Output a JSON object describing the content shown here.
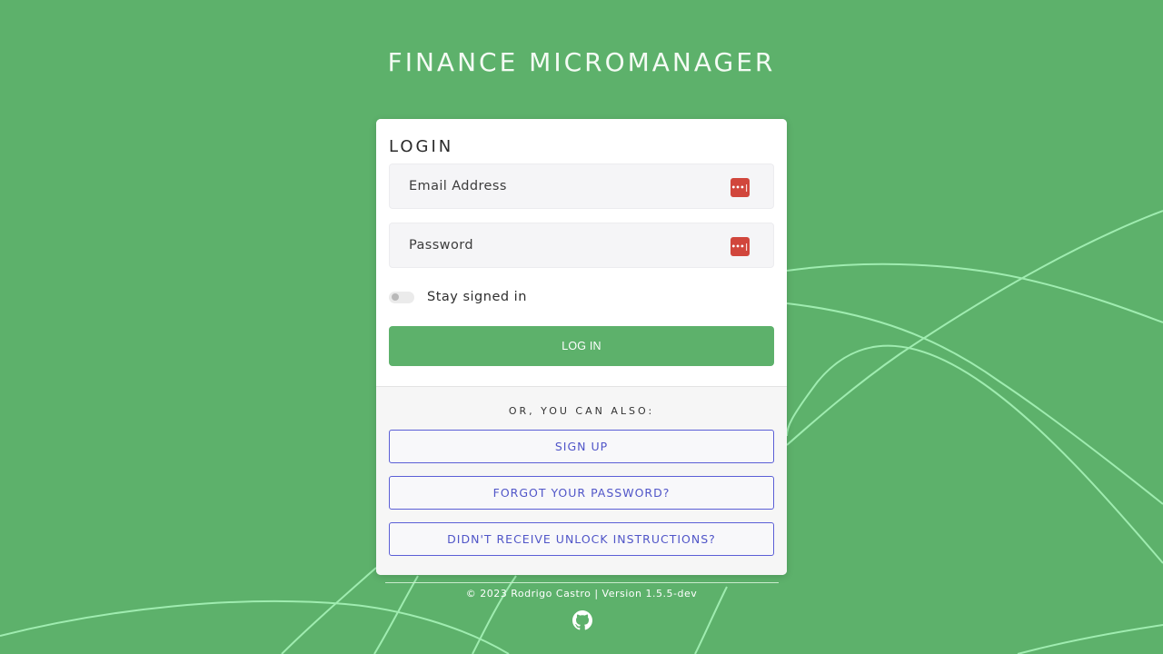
{
  "app": {
    "title": "FINANCE MICROMANAGER"
  },
  "login": {
    "heading": "LOGIN",
    "email_placeholder": "Email Address",
    "password_placeholder": "Password",
    "stay_signed_in_label": "Stay signed in",
    "stay_signed_in_checked": false,
    "submit_label": "LOG IN"
  },
  "alternatives": {
    "heading": "OR, YOU CAN ALSO:",
    "sign_up_label": "SIGN UP",
    "forgot_password_label": "FORGOT YOUR PASSWORD?",
    "unlock_instructions_label": "DIDN'T RECEIVE UNLOCK INSTRUCTIONS?"
  },
  "footer": {
    "text": "© 2023 Rodrigo Castro | Version 1.5.5-dev",
    "github_icon": "github-icon"
  },
  "password_manager_icon": "password-manager-icon",
  "colors": {
    "background": "#5db16b",
    "primary_button": "#5db16b",
    "link_border": "#5b5fd6",
    "link_text": "#5055c8",
    "password_icon": "#d1463c",
    "curve_lines": "#9fecb0"
  }
}
